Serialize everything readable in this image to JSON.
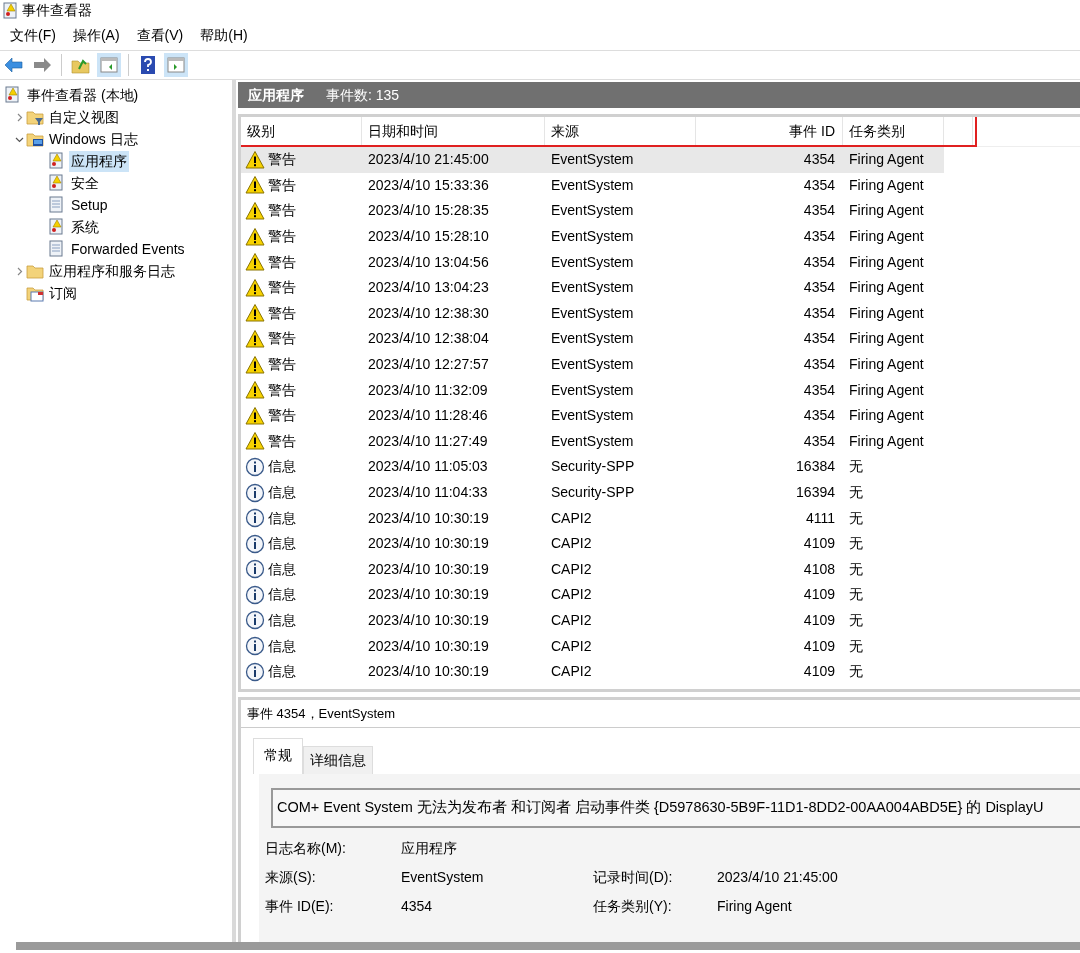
{
  "window": {
    "title": "事件查看器"
  },
  "menu": [
    "文件(F)",
    "操作(A)",
    "查看(V)",
    "帮助(H)"
  ],
  "tree": [
    {
      "label": "事件查看器 (本地)",
      "kind": "root",
      "selected": false,
      "children": [
        {
          "label": "自定义视图",
          "kind": "filter-folder",
          "expanded": false,
          "selected": false
        },
        {
          "label": "Windows 日志",
          "kind": "log-folder",
          "expanded": true,
          "selected": false,
          "children": [
            {
              "label": "应用程序",
              "kind": "alert-log",
              "selected": true
            },
            {
              "label": "安全",
              "kind": "alert-log",
              "selected": false
            },
            {
              "label": "Setup",
              "kind": "log",
              "selected": false
            },
            {
              "label": "系统",
              "kind": "alert-log",
              "selected": false
            },
            {
              "label": "Forwarded Events",
              "kind": "log",
              "selected": false
            }
          ]
        },
        {
          "label": "应用程序和服务日志",
          "kind": "folder",
          "expanded": false,
          "selected": false
        },
        {
          "label": "订阅",
          "kind": "subscription",
          "selected": false
        }
      ]
    }
  ],
  "pane_header": {
    "title": "应用程序",
    "count": "事件数: 135"
  },
  "table": {
    "columns": [
      "级别",
      "日期和时间",
      "来源",
      "事件 ID",
      "任务类别"
    ],
    "rows": [
      {
        "kind": "warning",
        "level": "警告",
        "time": "2023/4/10 21:45:00",
        "source": "EventSystem",
        "id": "4354",
        "task": "Firing Agent",
        "selected": true
      },
      {
        "kind": "warning",
        "level": "警告",
        "time": "2023/4/10 15:33:36",
        "source": "EventSystem",
        "id": "4354",
        "task": "Firing Agent",
        "selected": false
      },
      {
        "kind": "warning",
        "level": "警告",
        "time": "2023/4/10 15:28:35",
        "source": "EventSystem",
        "id": "4354",
        "task": "Firing Agent",
        "selected": false
      },
      {
        "kind": "warning",
        "level": "警告",
        "time": "2023/4/10 15:28:10",
        "source": "EventSystem",
        "id": "4354",
        "task": "Firing Agent",
        "selected": false
      },
      {
        "kind": "warning",
        "level": "警告",
        "time": "2023/4/10 13:04:56",
        "source": "EventSystem",
        "id": "4354",
        "task": "Firing Agent",
        "selected": false
      },
      {
        "kind": "warning",
        "level": "警告",
        "time": "2023/4/10 13:04:23",
        "source": "EventSystem",
        "id": "4354",
        "task": "Firing Agent",
        "selected": false
      },
      {
        "kind": "warning",
        "level": "警告",
        "time": "2023/4/10 12:38:30",
        "source": "EventSystem",
        "id": "4354",
        "task": "Firing Agent",
        "selected": false
      },
      {
        "kind": "warning",
        "level": "警告",
        "time": "2023/4/10 12:38:04",
        "source": "EventSystem",
        "id": "4354",
        "task": "Firing Agent",
        "selected": false
      },
      {
        "kind": "warning",
        "level": "警告",
        "time": "2023/4/10 12:27:57",
        "source": "EventSystem",
        "id": "4354",
        "task": "Firing Agent",
        "selected": false
      },
      {
        "kind": "warning",
        "level": "警告",
        "time": "2023/4/10 11:32:09",
        "source": "EventSystem",
        "id": "4354",
        "task": "Firing Agent",
        "selected": false
      },
      {
        "kind": "warning",
        "level": "警告",
        "time": "2023/4/10 11:28:46",
        "source": "EventSystem",
        "id": "4354",
        "task": "Firing Agent",
        "selected": false
      },
      {
        "kind": "warning",
        "level": "警告",
        "time": "2023/4/10 11:27:49",
        "source": "EventSystem",
        "id": "4354",
        "task": "Firing Agent",
        "selected": false
      },
      {
        "kind": "info",
        "level": "信息",
        "time": "2023/4/10 11:05:03",
        "source": "Security-SPP",
        "id": "16384",
        "task": "无",
        "selected": false
      },
      {
        "kind": "info",
        "level": "信息",
        "time": "2023/4/10 11:04:33",
        "source": "Security-SPP",
        "id": "16394",
        "task": "无",
        "selected": false
      },
      {
        "kind": "info",
        "level": "信息",
        "time": "2023/4/10 10:30:19",
        "source": "CAPI2",
        "id": "4111",
        "task": "无",
        "selected": false
      },
      {
        "kind": "info",
        "level": "信息",
        "time": "2023/4/10 10:30:19",
        "source": "CAPI2",
        "id": "4109",
        "task": "无",
        "selected": false
      },
      {
        "kind": "info",
        "level": "信息",
        "time": "2023/4/10 10:30:19",
        "source": "CAPI2",
        "id": "4108",
        "task": "无",
        "selected": false
      },
      {
        "kind": "info",
        "level": "信息",
        "time": "2023/4/10 10:30:19",
        "source": "CAPI2",
        "id": "4109",
        "task": "无",
        "selected": false
      },
      {
        "kind": "info",
        "level": "信息",
        "time": "2023/4/10 10:30:19",
        "source": "CAPI2",
        "id": "4109",
        "task": "无",
        "selected": false
      },
      {
        "kind": "info",
        "level": "信息",
        "time": "2023/4/10 10:30:19",
        "source": "CAPI2",
        "id": "4109",
        "task": "无",
        "selected": false
      },
      {
        "kind": "info",
        "level": "信息",
        "time": "2023/4/10 10:30:19",
        "source": "CAPI2",
        "id": "4109",
        "task": "无",
        "selected": false
      }
    ]
  },
  "detail": {
    "title": "事件 4354，EventSystem",
    "tabs": [
      {
        "label": "常规",
        "selected": true
      },
      {
        "label": "详细信息",
        "selected": false
      }
    ],
    "message": "COM+ Event System 无法为发布者  和订阅者  启动事件类 {D5978630-5B9F-11D1-8DD2-00AA004ABD5E} 的 DisplayU",
    "fields": [
      [
        {
          "label": "日志名称(M):",
          "value": "应用程序"
        }
      ],
      [
        {
          "label": "来源(S):",
          "value": "EventSystem"
        },
        {
          "label": "记录时间(D):",
          "value": "2023/4/10 21:45:00"
        }
      ],
      [
        {
          "label": "事件 ID(E):",
          "value": "4354"
        },
        {
          "label": "任务类别(Y):",
          "value": "Firing Agent"
        }
      ]
    ]
  }
}
